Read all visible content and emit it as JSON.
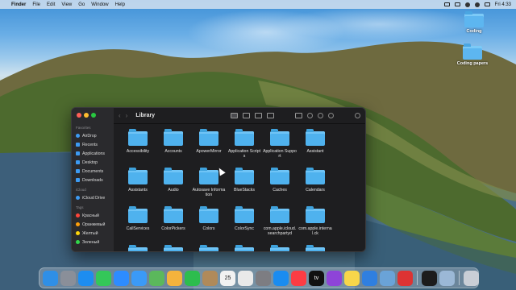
{
  "menubar": {
    "app_name": "Finder",
    "menus": [
      "File",
      "Edit",
      "View",
      "Go",
      "Window",
      "Help"
    ],
    "clock": "Fri 4:33"
  },
  "desktop": {
    "icons": [
      {
        "label": "Coding"
      },
      {
        "label": "Coding papers"
      }
    ]
  },
  "finder": {
    "title": "Library",
    "sidebar": {
      "favorites_header": "Favorites",
      "favorites": [
        {
          "label": "AirDrop",
          "icon": "airdrop-icon"
        },
        {
          "label": "Recents",
          "icon": "clock-icon"
        },
        {
          "label": "Applications",
          "icon": "applications-icon"
        },
        {
          "label": "Desktop",
          "icon": "desktop-icon"
        },
        {
          "label": "Documents",
          "icon": "document-icon"
        },
        {
          "label": "Downloads",
          "icon": "download-icon"
        }
      ],
      "icloud_header": "iCloud",
      "icloud": [
        {
          "label": "iCloud Drive",
          "icon": "cloud-icon"
        }
      ],
      "tags_header": "Tags",
      "tags": [
        {
          "label": "Красный",
          "color": "#ff453a"
        },
        {
          "label": "Оранжевый",
          "color": "#ff9f0a"
        },
        {
          "label": "Желтый",
          "color": "#ffd60a"
        },
        {
          "label": "Зеленый",
          "color": "#32d74b"
        }
      ]
    },
    "items": [
      "Accessibility",
      "Accounts",
      "ApowerMirror",
      "Application Scripts",
      "Application Support",
      "Assistant",
      "Assistants",
      "Audio",
      "Autosave Information",
      "BlueStacks",
      "Caches",
      "Calendars",
      "CallServices",
      "ColorPickers",
      "Colors",
      "ColorSync",
      "com.apple.icloud.searchpartyd",
      "com.apple.internal.ck",
      "",
      "",
      "",
      "",
      "",
      ""
    ]
  },
  "dock": {
    "apps": [
      {
        "name": "finder",
        "color": "#2f8fe6"
      },
      {
        "name": "launchpad",
        "color": "#8a8f99"
      },
      {
        "name": "safari",
        "color": "#1d8df0"
      },
      {
        "name": "messages",
        "color": "#34c759"
      },
      {
        "name": "zoom",
        "color": "#2d8cff"
      },
      {
        "name": "mail",
        "color": "#3b9af7"
      },
      {
        "name": "maps",
        "color": "#5bb85c"
      },
      {
        "name": "photos",
        "color": "#f4b33c"
      },
      {
        "name": "facetime",
        "color": "#2dbd4e"
      },
      {
        "name": "contacts",
        "color": "#b08a5a"
      },
      {
        "name": "calendar",
        "color": "#f2f2f2"
      },
      {
        "name": "reminders",
        "color": "#e9e9e9"
      },
      {
        "name": "settings",
        "color": "#7d7d82"
      },
      {
        "name": "app-store",
        "color": "#1a8cf0"
      },
      {
        "name": "music",
        "color": "#fc3c44"
      },
      {
        "name": "apple-tv",
        "color": "#111111"
      },
      {
        "name": "podcasts",
        "color": "#8e44d8"
      },
      {
        "name": "notes",
        "color": "#f7d64a"
      },
      {
        "name": "keynote",
        "color": "#2f7fe0"
      },
      {
        "name": "preview",
        "color": "#6aa3d8"
      },
      {
        "name": "no-entry",
        "color": "#d33"
      },
      {
        "name": "terminal",
        "color": "#1c1c1c"
      },
      {
        "name": "quicktime",
        "color": "#9bb8d6"
      },
      {
        "name": "trash",
        "color": "#c9ced6"
      }
    ],
    "calendar_day": "25",
    "tv_label": "tv"
  }
}
